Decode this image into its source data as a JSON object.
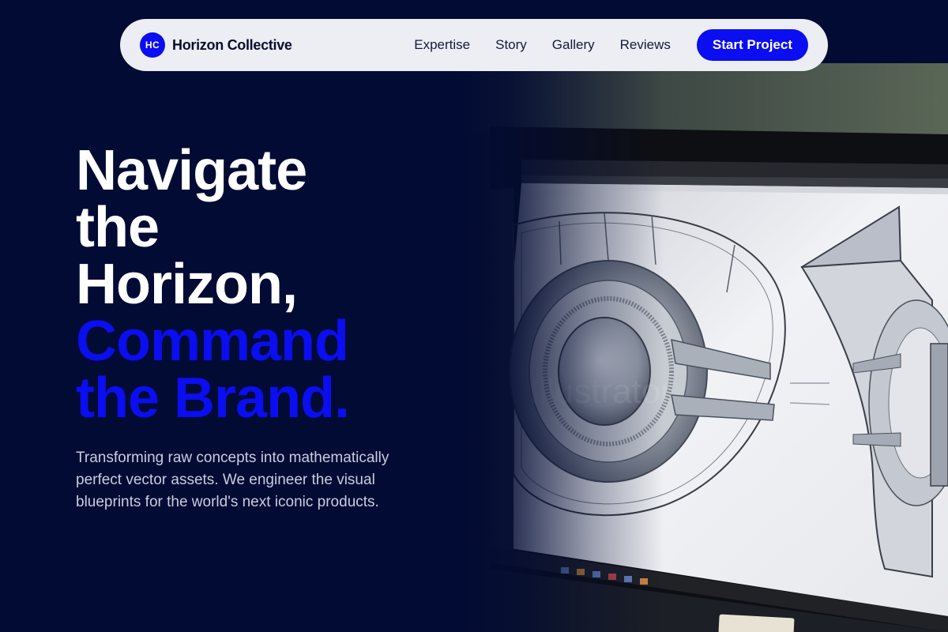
{
  "brand": {
    "mark": "HC",
    "name": "Horizon Collective",
    "accent_color": "#0a0ef0"
  },
  "nav": {
    "links": [
      "Expertise",
      "Story",
      "Gallery",
      "Reviews"
    ],
    "cta_label": "Start Project"
  },
  "hero": {
    "headline_white": [
      "Navigate",
      "the",
      "Horizon,"
    ],
    "headline_blue": [
      "Command",
      "the Brand."
    ],
    "subtext": "Transforming raw concepts into mathematically perfect vector assets. We engineer the visual blueprints for the world's next iconic products.",
    "image_description_icon": "monitor-design-photo"
  }
}
